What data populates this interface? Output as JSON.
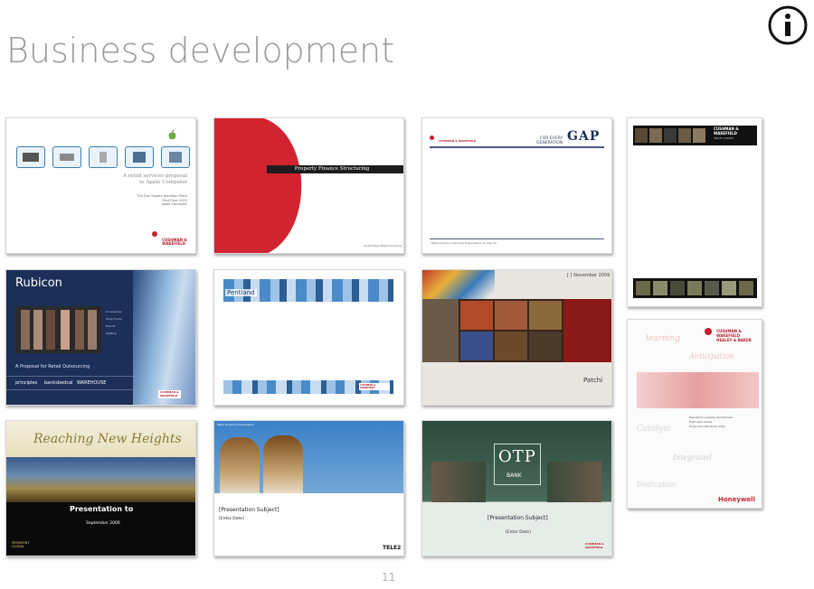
{
  "page": {
    "title": "Business development",
    "page_number": "11",
    "info_icon": "info-circle-icon"
  },
  "slides": {
    "apple": {
      "text": "A retail services proposal\nto Apple Computer",
      "small": "The Dun Square Hamilton Place\nFirst Floor 2003\nApple Computer",
      "brand": "CUSHMAN &\nWAKEFIELD"
    },
    "property": {
      "banner": "Property Finance Structuring",
      "footer": "Global Real Estate Solutions"
    },
    "gap": {
      "brand1": "CUSHMAN & WAKEFIELD",
      "tag": "FOR EVERY\nGENERATION",
      "logo": "GAP",
      "footer": "Retail Advisory Services Presentation to Gap Inc."
    },
    "cwfilm": {
      "brand": "CUSHMAN &\nWAKEFIELD",
      "sub": "HEALEY & BAKER"
    },
    "rubicon": {
      "logo": "Rubicon",
      "caption": "A Proposal for Retail Outsourcing",
      "partners": [
        "principles",
        "banksbedcal",
        "WAREHOUSE"
      ],
      "menu": [
        "Accessories",
        "Shop Fronts",
        "Brands",
        "Staffing"
      ],
      "brand": "CUSHMAN &\nWAKEFIELD"
    },
    "pentland": {
      "logo": "Pentland",
      "brand": "CUSHMAN & WAKEFIELD"
    },
    "patchi": {
      "date": "[ ] November 2006",
      "brand": "Patchi"
    },
    "honeywell": {
      "brand": "CUSHMAN &\nWAKEFIELD\nHEALEY & BAKER",
      "words": [
        "learning",
        "Anticipation",
        "Catalyst",
        "Integrated",
        "Dedication"
      ],
      "details": "Request for property development\nFresh start review\nFriday 22nd November 2002",
      "logo": "Honeywell"
    },
    "peermont": {
      "headline": "Reaching New Heights",
      "sub": "Presentation to",
      "date": "September 2006",
      "logo": "PEERMONT\nGLOBAL"
    },
    "tele2": {
      "header": "Tele2 Property Presentation",
      "subject": "[Presentation Subject]",
      "date": "[Enter Date]",
      "logo": "TELE2"
    },
    "otp": {
      "logo": "OTP",
      "bank": "BANK",
      "subject": "[Presentation Subject]",
      "date": "[Enter Date]",
      "brand": "CUSHMAN &\nWAKEFIELD"
    }
  },
  "colors": {
    "title": "#9a9a9a",
    "red": "#d02530",
    "navy": "#1c2f58",
    "green": "#2c4a3e"
  }
}
